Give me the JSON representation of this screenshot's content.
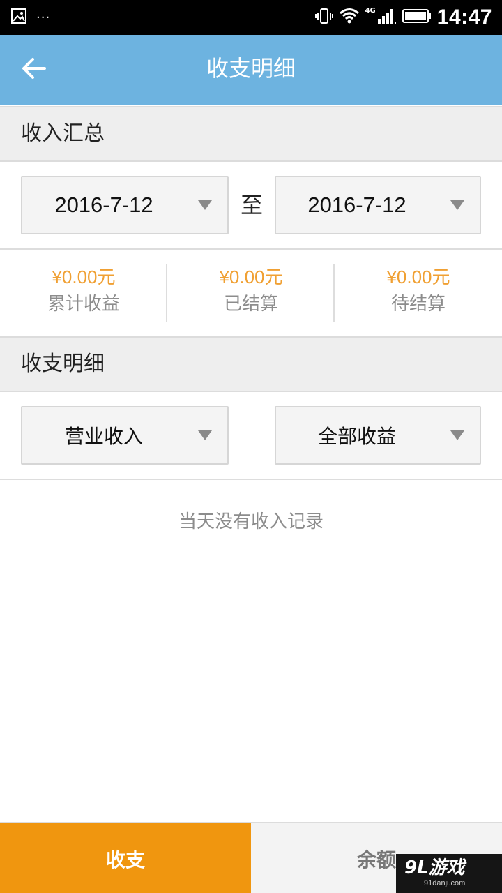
{
  "status_bar": {
    "time": "14:47",
    "network": "4G",
    "more": "···"
  },
  "header": {
    "title": "收支明细"
  },
  "summary_section": {
    "title": "收入汇总",
    "start_date": "2016-7-12",
    "range_separator": "至",
    "end_date": "2016-7-12",
    "stats": [
      {
        "amount": "¥0.00元",
        "label": "累计收益"
      },
      {
        "amount": "¥0.00元",
        "label": "已结算"
      },
      {
        "amount": "¥0.00元",
        "label": "待结算"
      }
    ]
  },
  "detail_section": {
    "title": "收支明细",
    "filter_type": "营业收入",
    "filter_scope": "全部收益",
    "empty_message": "当天没有收入记录"
  },
  "bottom_tabs": [
    {
      "label": "收支",
      "active": true
    },
    {
      "label": "余额",
      "active": false
    }
  ],
  "watermark": {
    "logo": "9L游戏",
    "url": "91danji.com"
  },
  "colors": {
    "app_bar": "#6db3e0",
    "accent_orange": "#f0960f",
    "amount_text": "#f0a033"
  }
}
